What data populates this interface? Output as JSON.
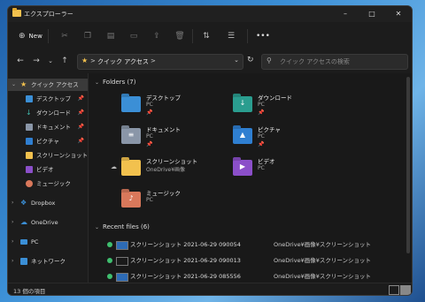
{
  "window": {
    "title": "エクスプローラー"
  },
  "command_bar": {
    "new_label": "New",
    "more_label": "•••"
  },
  "address_bar": {
    "crumb_sep1": ">",
    "location": "クイック アクセス",
    "crumb_sep2": ">",
    "search_placeholder": "クイック アクセスの検索"
  },
  "sidebar": {
    "items": [
      {
        "label": "クイック アクセス",
        "icon": "star-icon"
      },
      {
        "label": "デスクトップ",
        "icon": "desktop-folder-icon"
      },
      {
        "label": "ダウンロード",
        "icon": "download-folder-icon"
      },
      {
        "label": "ドキュメント",
        "icon": "documents-folder-icon"
      },
      {
        "label": "ピクチャ",
        "icon": "pictures-folder-icon"
      },
      {
        "label": "スクリーンショット",
        "icon": "folder-icon"
      },
      {
        "label": "ビデオ",
        "icon": "videos-folder-icon"
      },
      {
        "label": "ミュージック",
        "icon": "music-folder-icon"
      },
      {
        "label": "Dropbox",
        "icon": "dropbox-icon"
      },
      {
        "label": "OneDrive",
        "icon": "onedrive-icon"
      },
      {
        "label": "PC",
        "icon": "pc-icon"
      },
      {
        "label": "ネットワーク",
        "icon": "network-icon"
      }
    ]
  },
  "folders_section": {
    "title": "Folders (7)",
    "items": [
      {
        "name": "デスクトップ",
        "location": "PC",
        "pinned": true,
        "color": "#3b8fd6"
      },
      {
        "name": "ダウンロード",
        "location": "PC",
        "pinned": true,
        "color": "#2a9d8f"
      },
      {
        "name": "ドキュメント",
        "location": "PC",
        "pinned": true,
        "color": "#8a96a8"
      },
      {
        "name": "ピクチャ",
        "location": "PC",
        "pinned": true,
        "color": "#2f7fd1"
      },
      {
        "name": "スクリーンショット",
        "location": "OneDrive¥画像",
        "pinned": false,
        "color": "#f2c14e"
      },
      {
        "name": "ビデオ",
        "location": "PC",
        "pinned": false,
        "color": "#8b4fc9"
      },
      {
        "name": "ミュージック",
        "location": "PC",
        "pinned": false,
        "color": "#d9785b"
      }
    ]
  },
  "recent_section": {
    "title": "Recent files (6)",
    "items": [
      {
        "name": "スクリーンショット 2021-06-29 090054",
        "location": "OneDrive¥画像¥スクリーンショット"
      },
      {
        "name": "スクリーンショット 2021-06-29 090013",
        "location": "OneDrive¥画像¥スクリーンショット"
      },
      {
        "name": "スクリーンショット 2021-06-29 085556",
        "location": "OneDrive¥画像¥スクリーンショット"
      }
    ]
  },
  "status_bar": {
    "item_count": "13 個の項目"
  }
}
